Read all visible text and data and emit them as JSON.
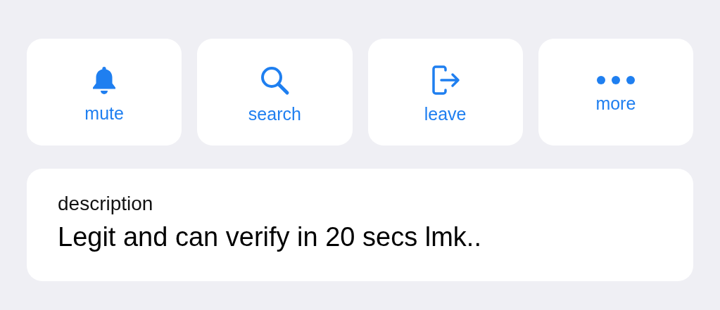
{
  "actions": [
    {
      "kind": "bell",
      "label": "mute"
    },
    {
      "kind": "search",
      "label": "search"
    },
    {
      "kind": "exit",
      "label": "leave"
    },
    {
      "kind": "dots",
      "label": "more"
    }
  ],
  "description": {
    "label": "description",
    "text": "Legit and can verify in 20 secs lmk.."
  }
}
